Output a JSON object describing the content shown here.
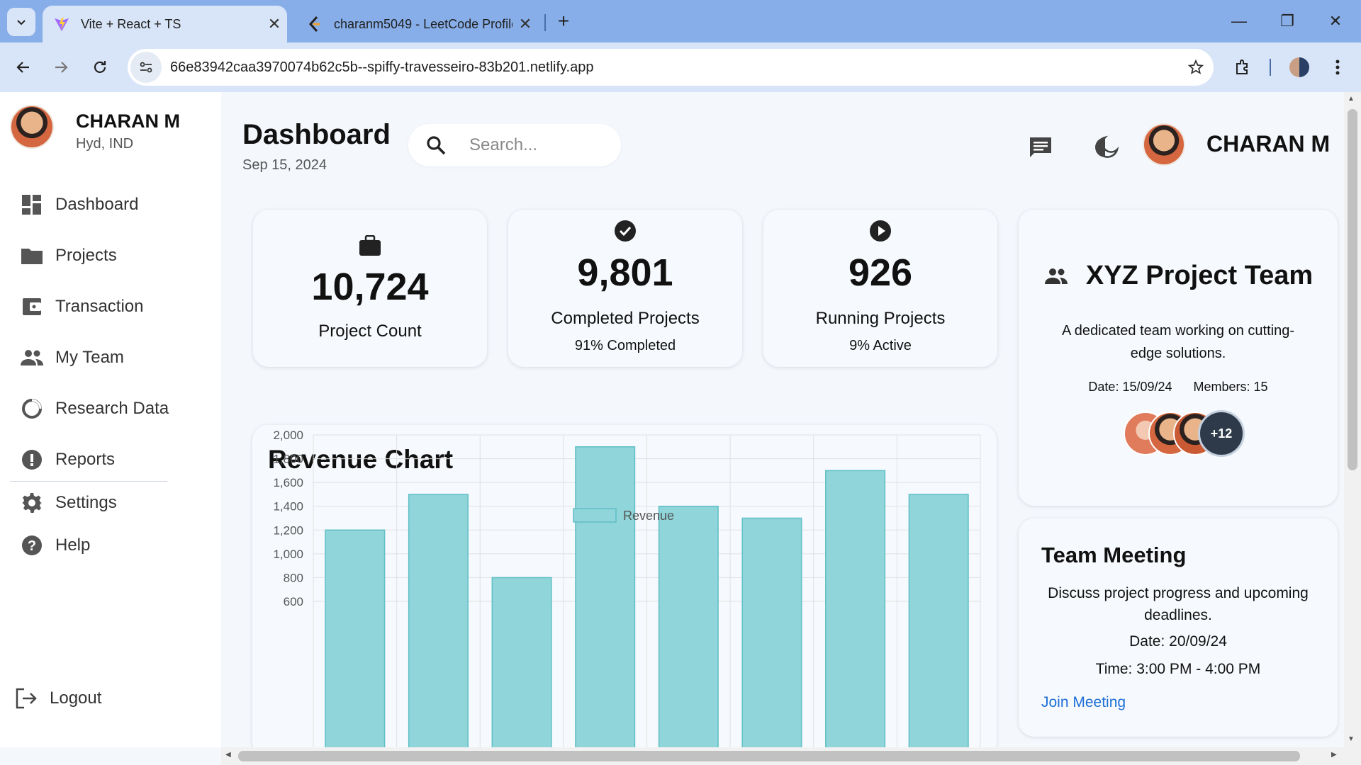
{
  "browser": {
    "tabs": [
      {
        "title": "Vite + React + TS"
      },
      {
        "title": "charanm5049 - LeetCode Profile"
      }
    ],
    "url": "66e83942caa3970074b62c5b--spiffy-travesseiro-83b201.netlify.app"
  },
  "sidebar": {
    "profile_name": "CHARAN M",
    "profile_location": "Hyd, IND",
    "items": [
      {
        "label": "Dashboard",
        "icon": "dashboard-icon"
      },
      {
        "label": "Projects",
        "icon": "folder-icon"
      },
      {
        "label": "Transaction",
        "icon": "wallet-icon"
      },
      {
        "label": "My Team",
        "icon": "people-icon"
      },
      {
        "label": "Research Data",
        "icon": "donut-icon"
      },
      {
        "label": "Reports",
        "icon": "alert-icon"
      },
      {
        "label": "Settings",
        "icon": "gear-icon"
      },
      {
        "label": "Help",
        "icon": "help-icon"
      }
    ],
    "logout": "Logout"
  },
  "header": {
    "title": "Dashboard",
    "date": "Sep 15, 2024",
    "search_placeholder": "Search...",
    "user_name": "CHARAN M"
  },
  "stats": [
    {
      "icon": "briefcase-icon",
      "value": "10,724",
      "label": "Project Count",
      "sub": ""
    },
    {
      "icon": "check-circle-icon",
      "value": "9,801",
      "label": "Completed Projects",
      "sub": "91% Completed"
    },
    {
      "icon": "play-circle-icon",
      "value": "926",
      "label": "Running Projects",
      "sub": "9% Active"
    }
  ],
  "revenue": {
    "title": "Revenue Chart"
  },
  "chart_data": {
    "type": "bar",
    "title": "Revenue Chart",
    "series": [
      {
        "name": "Revenue",
        "values": [
          1200,
          1500,
          800,
          1900,
          1400,
          1300,
          1700,
          1500
        ]
      }
    ],
    "y_ticks": [
      "2,000",
      "1,800",
      "1,600",
      "1,400",
      "1,200",
      "1,000",
      "800",
      "600"
    ],
    "ylim": [
      600,
      2000
    ],
    "legend": "top-center",
    "grid": true,
    "colors": {
      "fill": "#8fd5d9",
      "stroke": "#5fbfc6"
    }
  },
  "team": {
    "title": "XYZ Project Team",
    "description": "A dedicated team working on cutting-edge solutions.",
    "date": "Date: 15/09/24",
    "members": "Members: 15",
    "more": "+12"
  },
  "meeting": {
    "title": "Team Meeting",
    "description": "Discuss project progress and upcoming deadlines.",
    "date": "Date: 20/09/24",
    "time": "Time: 3:00 PM - 4:00 PM",
    "link": "Join Meeting"
  },
  "colors": {
    "accent": "#1e6fd6",
    "chrome": "#87aee8",
    "toolbar": "#d8e4f7"
  }
}
